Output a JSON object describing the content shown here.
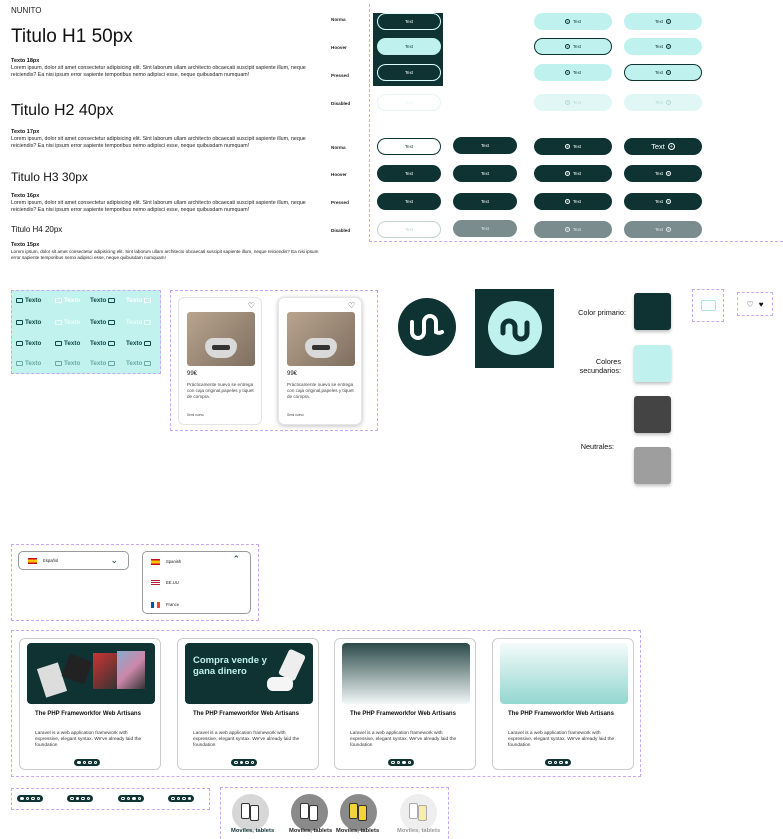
{
  "typography": {
    "font_label": "NUNITO",
    "h1": "Titulo H1 50px",
    "h2": "Titulo H2 40px",
    "h3": "Titulo H3 30px",
    "h4": "Titulo H4 20px",
    "t18": "Texto 18px",
    "t17": "Texto 17px",
    "t16": "Texto 16px",
    "t15": "Texto 15px",
    "p18": "Lorem ipsum, dolor sit amet consectetur adipisicing elit. Sint laborum ullam architecto obcaecati suscipit sapiente illum, neque reiciendis? Ea nisi ipsum error sapiente temporibus nemo adipisci esse, neque quibusdam numquam!",
    "p17": "Lorem ipsum, dolor sit amet consectetur adipisicing elit. Sint laborum ullam architecto obcaecati suscipit sapiente illum, neque reiciendis? Ea nisi ipsum error sapiente temporibus nemo adipisci esse, neque quibusdam numquam!",
    "p16": "Lorem ipsum, dolor sit amet consectetur adipisicing elit. Sint laborum ullam architecto obcaecati suscipit sapiente illum, neque reiciendis? Ea nisi ipsum error sapiente temporibus nemo adipisci esse, neque quibusdam numquam!",
    "p15": "Lorem ipsum, dolor sit amet consectetur adipisicing elit. Sint laborum ullam architecto obcaecati suscipit sapiente illum, neque reiciendis? Ea nisi ipsum error sapiente temporibus nemo adipisci esse, neque quibusdam numquam!"
  },
  "states": {
    "normal": "Norma",
    "hover": "Hoover",
    "pressed": "Pressed",
    "disabled": "Disabled"
  },
  "button_text": "Text",
  "tag_text": "Texto",
  "product": {
    "price": "99€",
    "desc": "Prácticamente nuevo se entrega con caja original,papeles y tiquet de compra.",
    "condition": "Semi nuevo"
  },
  "colors": {
    "primary_label": "Color primario:",
    "secondary_label": "Colores secundarios:",
    "neutral_label": "Neutrales:",
    "primary": "#0f3333",
    "secondary": "#bff2ee",
    "neutral_dark": "#444444",
    "neutral_light": "#9e9e9e"
  },
  "language": {
    "selected": "Español",
    "options": [
      "Spanish",
      "EE.UU",
      "France"
    ]
  },
  "blog": {
    "promo_text": "Compra vende y gana dinero",
    "title": "The PHP Frameworkfor Web Artisans",
    "desc": "Laravel is a web application framework with expressive, elegant syntax. We've already laid the foundation"
  },
  "category_label": "Moviles, tablets"
}
